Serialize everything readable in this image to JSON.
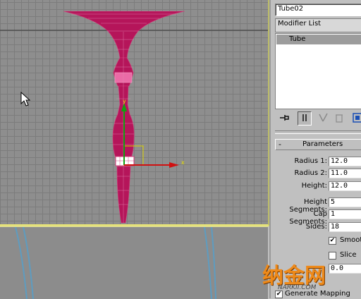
{
  "command_panel": {
    "object_name": "Tube02",
    "modifier_list_label": "Modifier List",
    "stack_items": [
      "Tube"
    ],
    "toolbar": {
      "pin_icon": "pin-stack-icon",
      "show_end_icon": "show-end-result-icon",
      "make_unique_icon": "make-unique-icon",
      "remove_modifier_icon": "remove-modifier-icon",
      "configure_icon": "configure-sets-icon"
    },
    "parameters": {
      "rollout_toggle": "-",
      "rollout_title": "Parameters",
      "radius1_label": "Radius 1:",
      "radius1_value": "12.0",
      "radius2_label": "Radius 2:",
      "radius2_value": "11.0",
      "height_label": "Height:",
      "height_value": "12.0",
      "height_segments_label": "Height Segments:",
      "height_segments_value": "5",
      "cap_segments_label": "Cap Segments:",
      "cap_segments_value": "1",
      "sides_label": "Sides:",
      "sides_value": "18",
      "smooth_label": "Smooth",
      "smooth_checked": true,
      "slice_label": "Slice",
      "slice_checked": false,
      "slice_value": "0.0",
      "generate_label": "Generate Mapping"
    }
  },
  "viewport": {
    "axis_x_label": "x",
    "axis_y_label": "y",
    "object_color": "#b5155a",
    "grid_color": "#8e8e8e",
    "axis_x_color": "#d01010",
    "axis_y_color": "#10a010"
  },
  "watermark": {
    "text": "纳金网",
    "subtext": "NARKII.COM"
  },
  "colors": {
    "panel": "#c0c0c0",
    "selection": "#9c9c9c",
    "viewport_border": "#e6e27a"
  }
}
